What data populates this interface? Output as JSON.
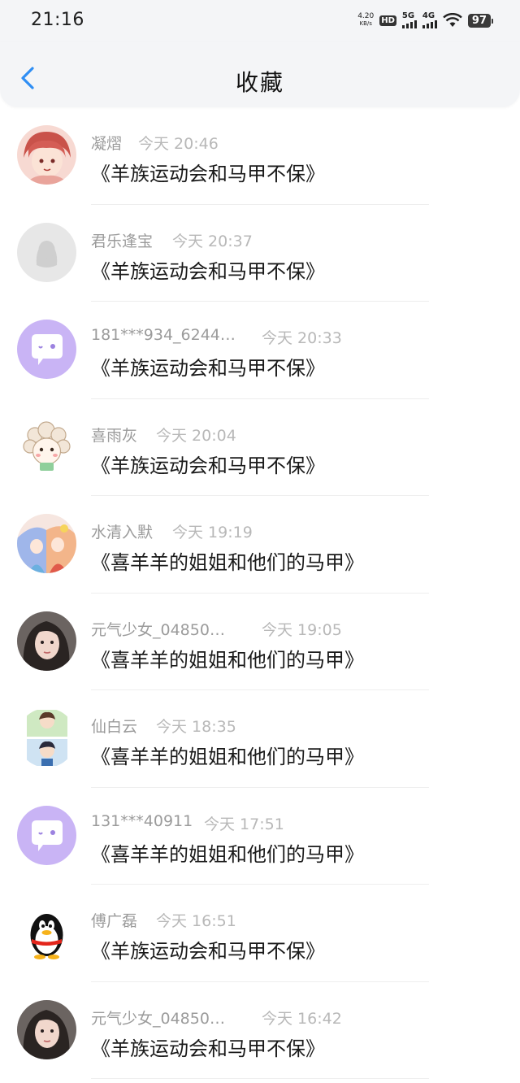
{
  "status_bar": {
    "time": "21:16",
    "net_speed_value": "4.20",
    "net_speed_unit": "KB/s",
    "hd_label": "HD",
    "sim1_label": "5G",
    "sim2_label": "4G",
    "battery": "97"
  },
  "header": {
    "title": "收藏",
    "back_icon": "chevron-left-icon",
    "accent_color": "#2f8ef4"
  },
  "favorites": [
    {
      "name": "凝熠",
      "time": "今天 20:46",
      "content": "《羊族运动会和马甲不保》",
      "avatar": "anime-red-hair"
    },
    {
      "name": "君乐逢宝",
      "time": "今天 20:37",
      "content": "《羊族运动会和马甲不保》",
      "avatar": "default-gray"
    },
    {
      "name": "181***934_6244…",
      "time": "今天 20:33",
      "content": "《羊族运动会和马甲不保》",
      "avatar": "purple-chat"
    },
    {
      "name": "喜雨灰",
      "time": "今天 20:04",
      "content": "《羊族运动会和马甲不保》",
      "avatar": "sheep-cartoon"
    },
    {
      "name": "水清入默",
      "time": "今天 19:19",
      "content": "《喜羊羊的姐姐和他们的马甲》",
      "avatar": "anime-colorful"
    },
    {
      "name": "元气少女_04850…",
      "time": "今天 19:05",
      "content": "《喜羊羊的姐姐和他们的马甲》",
      "avatar": "girl-photo"
    },
    {
      "name": "仙白云",
      "time": "今天 18:35",
      "content": "《喜羊羊的姐姐和他们的马甲》",
      "avatar": "two-boys"
    },
    {
      "name": "131***40911",
      "time": "今天 17:51",
      "content": "《喜羊羊的姐姐和他们的马甲》",
      "avatar": "purple-chat"
    },
    {
      "name": "傅广磊",
      "time": "今天 16:51",
      "content": "《羊族运动会和马甲不保》",
      "avatar": "penguin"
    },
    {
      "name": "元气少女_04850…",
      "time": "今天 16:42",
      "content": "《羊族运动会和马甲不保》",
      "avatar": "girl-photo"
    }
  ]
}
